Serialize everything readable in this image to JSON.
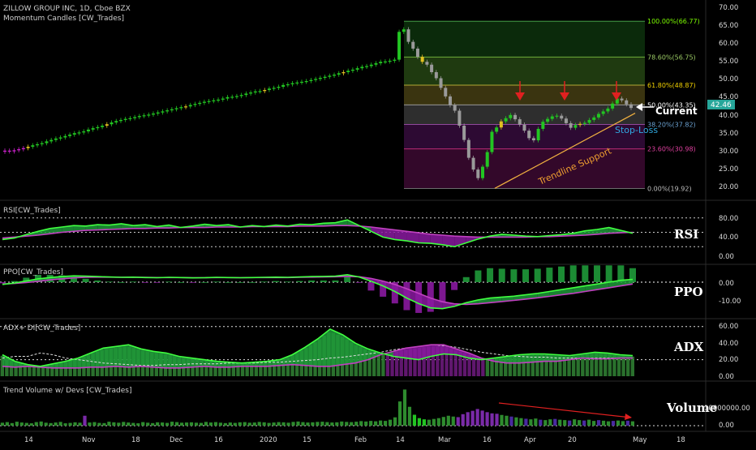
{
  "header": {
    "title": "ZILLOW GROUP INC, 1D, Cboe BZX",
    "overlay": "Momentum Candles [CW_Trades]"
  },
  "annotations": {
    "trendline": "Trendline Support",
    "current": "Current",
    "stop_loss": "Stop-Loss"
  },
  "axes": {
    "price_ticks": [
      "70.00",
      "65.00",
      "60.00",
      "55.00",
      "50.00",
      "45.00",
      "40.00",
      "35.00",
      "30.00",
      "25.00",
      "20.00"
    ],
    "last_price": "42.46",
    "date_ticks": [
      "14",
      "Nov",
      "18",
      "Dec",
      "16",
      "2020",
      "15",
      "Feb",
      "14",
      "Mar",
      "16",
      "Apr",
      "20",
      "",
      "May",
      "18"
    ]
  },
  "panels": {
    "rsi": {
      "label": "RSI[CW_Trades]",
      "name": "RSI",
      "ticks": [
        "80.00",
        "40.00",
        "0.00"
      ]
    },
    "ppo": {
      "label": "PPO[CW_Trades]",
      "name": "PPO",
      "ticks": [
        "0.00",
        "-10.00"
      ]
    },
    "adx": {
      "label": "ADX+ DI[CW_Trades]",
      "name": "ADX",
      "ticks": [
        "60.00",
        "40.00",
        "20.00",
        "0.00"
      ]
    },
    "volume": {
      "label": "Trend Volume w/ Devs [CW_Trades]",
      "name": "Volume",
      "ticks": [
        "10000000.00",
        "0.00"
      ]
    }
  },
  "colors": {
    "bull": "#22c522",
    "bear": "#9a9a9a",
    "magenta": "#cc22cc",
    "yellow": "#e0c020",
    "green_fill": "#1f9a3a",
    "purple_fill": "#8a1aa0"
  },
  "chart_data": [
    {
      "type": "candlestick",
      "title": "ZILLOW GROUP INC, 1D, Cboe BZX",
      "ylim": [
        18,
        72
      ],
      "x_categories": [
        "14",
        "Nov",
        "18",
        "Dec",
        "16",
        "2020",
        "15",
        "Feb",
        "14",
        "Mar",
        "16",
        "Apr",
        "20",
        "May",
        "18"
      ],
      "close": [
        30.5,
        30.3,
        30.6,
        30.9,
        31.2,
        31.6,
        32.0,
        32.3,
        32.6,
        33.1,
        33.5,
        33.9,
        34.2,
        34.6,
        35.0,
        35.4,
        35.6,
        35.9,
        36.4,
        36.8,
        37.1,
        37.5,
        37.9,
        38.4,
        38.8,
        39.1,
        39.4,
        39.6,
        39.9,
        40.2,
        40.4,
        40.6,
        40.9,
        41.2,
        41.5,
        41.8,
        42.1,
        42.4,
        42.7,
        42.9,
        43.3,
        43.6,
        43.9,
        44.2,
        44.4,
        44.6,
        44.8,
        45.1,
        45.5,
        45.6,
        45.8,
        46.1,
        46.5,
        46.8,
        47.1,
        47.2,
        47.5,
        47.9,
        48.1,
        48.4,
        48.9,
        49.1,
        49.4,
        49.6,
        49.8,
        50.0,
        50.3,
        50.6,
        50.9,
        51.2,
        51.5,
        51.8,
        52.2,
        52.5,
        52.9,
        53.2,
        53.6,
        54.0,
        54.2,
        54.6,
        55.0,
        55.4,
        55.5,
        55.7,
        56.0,
        63.8,
        64.5,
        61.0,
        59.1,
        56.8,
        55.4,
        54.6,
        52.5,
        50.8,
        48.1,
        45.7,
        43.2,
        41.7,
        37.5,
        33.5,
        28.5,
        25.2,
        22.8,
        26.0,
        30.1,
        35.8,
        37.0,
        38.7,
        39.6,
        40.5,
        39.3,
        37.8,
        36.1,
        34.0,
        33.4,
        36.6,
        38.6,
        39.4,
        40.1,
        40.3,
        39.5,
        38.2,
        36.9,
        37.7,
        38.0,
        38.3,
        39.1,
        39.8,
        40.8,
        41.5,
        42.3,
        43.7,
        45.1,
        44.6,
        43.5,
        42.46
      ],
      "fib_levels": [
        {
          "label": "100.00%(66.77)",
          "value": 66.77
        },
        {
          "label": "78.60%(56.75)",
          "value": 56.75
        },
        {
          "label": "61.80%(48.87)",
          "value": 48.87
        },
        {
          "label": "50.00%(43.35)",
          "value": 43.35
        },
        {
          "label": "38.20%(37.82)",
          "value": 37.82
        },
        {
          "label": "23.60%(30.98)",
          "value": 30.98
        },
        {
          "label": "0.00%(19.92)",
          "value": 19.92
        }
      ]
    },
    {
      "type": "line",
      "name": "RSI",
      "ylim": [
        0,
        100
      ],
      "levels": [
        80,
        50,
        20
      ],
      "series": [
        {
          "values": [
            35,
            38,
            45,
            52,
            58,
            61,
            64,
            63,
            66,
            65,
            68,
            64,
            66,
            62,
            65,
            60,
            63,
            67,
            64,
            66,
            61,
            64,
            62,
            65,
            63,
            67,
            66,
            69,
            70,
            76,
            64,
            52,
            40,
            35,
            32,
            28,
            27,
            24,
            20,
            28,
            36,
            42,
            46,
            44,
            42,
            41,
            43,
            45,
            48,
            53,
            56,
            60,
            54,
            48
          ]
        },
        {
          "values": [
            38,
            40,
            42,
            44,
            47,
            50,
            52,
            54,
            55,
            56,
            57,
            58,
            58,
            59,
            59,
            60,
            60,
            60,
            61,
            61,
            61,
            62,
            62,
            62,
            62,
            63,
            63,
            63,
            64,
            64,
            63,
            61,
            58,
            55,
            52,
            49,
            46,
            44,
            42,
            41,
            40,
            40,
            40,
            40,
            40,
            41,
            41,
            42,
            43,
            44,
            46,
            48,
            49,
            50
          ]
        }
      ]
    },
    {
      "type": "line",
      "name": "PPO",
      "ylim": [
        -16,
        6
      ],
      "series": [
        {
          "values": [
            -1.2,
            -0.5,
            0.6,
            1.8,
            2.5,
            3.0,
            3.4,
            3.2,
            3.0,
            2.8,
            2.6,
            2.7,
            2.5,
            2.4,
            2.6,
            2.5,
            2.3,
            2.4,
            2.6,
            2.5,
            2.4,
            2.5,
            2.6,
            2.7,
            2.6,
            2.8,
            3.0,
            3.1,
            3.2,
            4.0,
            2.8,
            0.5,
            -2.0,
            -5.0,
            -8.5,
            -11.5,
            -13.8,
            -14.2,
            -13.0,
            -11.0,
            -9.5,
            -8.5,
            -8.0,
            -7.5,
            -6.8,
            -6.0,
            -5.0,
            -4.0,
            -3.0,
            -2.0,
            -1.0,
            0.0,
            1.0,
            1.5
          ]
        },
        {
          "values": [
            -1.0,
            -0.7,
            -0.2,
            0.5,
            1.2,
            1.8,
            2.3,
            2.6,
            2.7,
            2.7,
            2.6,
            2.6,
            2.6,
            2.5,
            2.5,
            2.5,
            2.4,
            2.4,
            2.5,
            2.5,
            2.4,
            2.5,
            2.5,
            2.5,
            2.5,
            2.6,
            2.7,
            2.8,
            2.9,
            3.1,
            2.9,
            2.0,
            0.6,
            -1.2,
            -3.5,
            -6.0,
            -8.5,
            -10.5,
            -11.6,
            -11.9,
            -11.6,
            -11.0,
            -10.4,
            -9.8,
            -9.1,
            -8.4,
            -7.6,
            -6.8,
            -6.0,
            -5.0,
            -4.0,
            -3.0,
            -2.0,
            -1.0
          ]
        }
      ]
    },
    {
      "type": "line",
      "name": "ADX+ DI",
      "ylim": [
        0,
        65
      ],
      "series": [
        {
          "values": [
            26,
            18,
            14,
            12,
            15,
            18,
            22,
            28,
            34,
            36,
            38,
            33,
            30,
            28,
            24,
            22,
            20,
            18,
            17,
            16,
            17,
            18,
            20,
            26,
            35,
            45,
            57,
            50,
            40,
            33,
            28,
            24,
            22,
            20,
            24,
            27,
            26,
            22,
            20,
            22,
            24,
            26,
            27,
            27,
            26,
            25,
            27,
            29,
            28,
            26,
            25
          ]
        },
        {
          "values": [
            12,
            11,
            12,
            11,
            10,
            10,
            10,
            11,
            11,
            12,
            11,
            12,
            11,
            10,
            10,
            11,
            12,
            11,
            11,
            12,
            12,
            12,
            13,
            14,
            13,
            12,
            12,
            14,
            16,
            20,
            26,
            30,
            34,
            36,
            38,
            38,
            33,
            28,
            22,
            18,
            16,
            16,
            17,
            18,
            18,
            20,
            22,
            21,
            21,
            22,
            22
          ]
        },
        {
          "values": [
            22,
            24,
            24,
            28,
            26,
            22,
            20,
            18,
            16,
            15,
            14,
            13,
            13,
            14,
            14,
            15,
            15,
            15,
            16,
            16,
            16,
            17,
            17,
            18,
            19,
            20,
            22,
            23,
            25,
            27,
            29,
            32,
            34,
            36,
            38,
            37,
            35,
            32,
            29,
            27,
            25,
            24,
            23,
            23,
            22,
            22,
            22,
            22,
            22,
            22,
            22
          ]
        }
      ]
    },
    {
      "type": "bar",
      "name": "Trend Volume w/ Devs",
      "ylim": [
        0,
        19000000
      ],
      "values": [
        1.5,
        1.8,
        1.3,
        2.0,
        1.6,
        1.4,
        1.2,
        1.8,
        2.1,
        1.5,
        1.3,
        1.6,
        1.9,
        1.2,
        1.4,
        1.7,
        1.5,
        5.0,
        1.6,
        1.8,
        1.4,
        1.3,
        2.0,
        1.7,
        1.5,
        1.9,
        1.6,
        1.4,
        1.2,
        1.8,
        1.5,
        1.3,
        1.7,
        1.6,
        1.4,
        2.0,
        1.8,
        1.5,
        1.6,
        1.7,
        1.5,
        1.4,
        1.9,
        1.6,
        1.8,
        1.5,
        1.3,
        1.6,
        1.4,
        1.7,
        1.8,
        1.5,
        1.6,
        1.9,
        1.7,
        1.4,
        1.6,
        1.8,
        1.7,
        1.5,
        1.9,
        2.1,
        1.8,
        1.6,
        1.7,
        1.9,
        2.0,
        1.8,
        1.6,
        1.7,
        2.1,
        1.9,
        1.8,
        2.0,
        2.3,
        2.1,
        2.4,
        2.2,
        2.6,
        2.4,
        3.0,
        4.2,
        12.2,
        18.2,
        9.5,
        5.5,
        3.8,
        3.2,
        3.0,
        3.4,
        3.8,
        4.4,
        5.0,
        4.6,
        4.3,
        5.8,
        6.8,
        7.5,
        8.4,
        7.6,
        6.8,
        6.2,
        6.0,
        5.4,
        5.0,
        4.6,
        4.2,
        3.8,
        3.5,
        3.2,
        3.6,
        3.0,
        2.8,
        3.2,
        3.4,
        3.0,
        2.8,
        2.6,
        3.2,
        2.8,
        2.6,
        3.0,
        2.4,
        2.8,
        2.5,
        2.2,
        2.4,
        2.6,
        2.3,
        2.5,
        2.2
      ]
    }
  ]
}
